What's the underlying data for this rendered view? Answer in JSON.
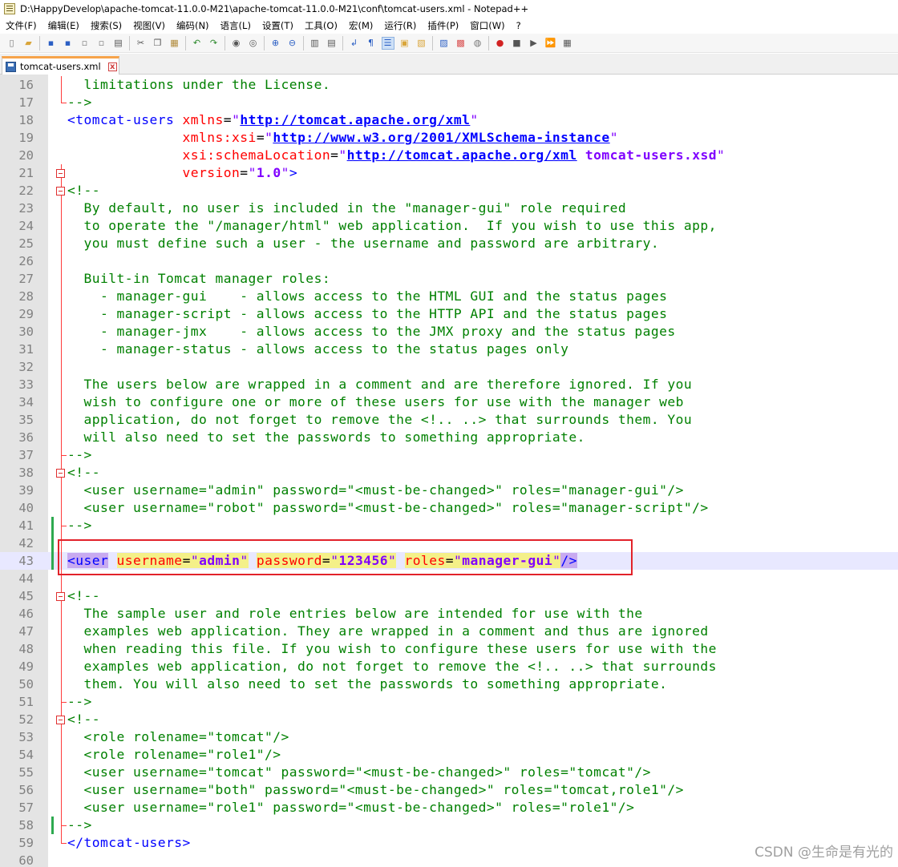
{
  "window": {
    "title": "D:\\HappyDevelop\\apache-tomcat-11.0.0-M21\\apache-tomcat-11.0.0-M21\\conf\\tomcat-users.xml - Notepad++"
  },
  "menu": [
    "文件(F)",
    "编辑(E)",
    "搜索(S)",
    "视图(V)",
    "编码(N)",
    "语言(L)",
    "设置(T)",
    "工具(O)",
    "宏(M)",
    "运行(R)",
    "插件(P)",
    "窗口(W)",
    "?"
  ],
  "toolbar": {
    "icons": [
      "new-file-icon",
      "open-file-icon",
      "save-icon",
      "save-all-icon",
      "close-icon",
      "close-all-icon",
      "print-icon",
      "cut-icon",
      "copy-icon",
      "paste-icon",
      "undo-icon",
      "redo-icon",
      "find-icon",
      "replace-icon",
      "zoom-in-icon",
      "zoom-out-icon",
      "sync-vertical-icon",
      "sync-horizontal-icon",
      "word-wrap-icon",
      "show-all-chars-icon",
      "indent-guide-icon",
      "language-icon",
      "doc-map-icon",
      "function-list-icon",
      "folder-as-workspace-icon",
      "monitoring-icon",
      "record-macro-icon",
      "stop-macro-icon",
      "play-macro-icon",
      "run-macro-multiple-icon",
      "save-macro-icon"
    ]
  },
  "tab": {
    "label": "tomcat-users.xml",
    "close": "x"
  },
  "editor": {
    "lines": [
      {
        "n": "16",
        "parts": [
          [
            "c-cmt",
            "  limitations under the License."
          ]
        ]
      },
      {
        "n": "17",
        "parts": [
          [
            "c-cmt",
            "-->"
          ]
        ]
      },
      {
        "n": "18",
        "parts": [
          [
            "c-tag",
            "<tomcat-users "
          ],
          [
            "c-attr",
            "xmlns"
          ],
          [
            "c-eq",
            "="
          ],
          [
            "c-q",
            "\""
          ],
          [
            "c-url",
            "http://tomcat.apache.org/xml"
          ],
          [
            "c-q",
            "\""
          ]
        ]
      },
      {
        "n": "19",
        "parts": [
          [
            "c-plain",
            "              "
          ],
          [
            "c-attr",
            "xmlns:xsi"
          ],
          [
            "c-eq",
            "="
          ],
          [
            "c-q",
            "\""
          ],
          [
            "c-url",
            "http://www.w3.org/2001/XMLSchema-instance"
          ],
          [
            "c-q",
            "\""
          ]
        ]
      },
      {
        "n": "20",
        "parts": [
          [
            "c-plain",
            "              "
          ],
          [
            "c-attr",
            "xsi:schemaLocation"
          ],
          [
            "c-eq",
            "="
          ],
          [
            "c-q",
            "\""
          ],
          [
            "c-url",
            "http://tomcat.apache.org/xml"
          ],
          [
            "c-val",
            " tomcat-users.xsd"
          ],
          [
            "c-q",
            "\""
          ]
        ]
      },
      {
        "n": "21",
        "parts": [
          [
            "c-plain",
            "              "
          ],
          [
            "c-attr",
            "version"
          ],
          [
            "c-eq",
            "="
          ],
          [
            "c-q",
            "\""
          ],
          [
            "c-val",
            "1.0"
          ],
          [
            "c-q",
            "\""
          ],
          [
            "c-tag",
            ">"
          ]
        ]
      },
      {
        "n": "22",
        "parts": [
          [
            "c-cmt",
            "<!--"
          ]
        ]
      },
      {
        "n": "23",
        "parts": [
          [
            "c-cmt",
            "  By default, no user is included in the \"manager-gui\" role required"
          ]
        ]
      },
      {
        "n": "24",
        "parts": [
          [
            "c-cmt",
            "  to operate the \"/manager/html\" web application.  If you wish to use this app,"
          ]
        ]
      },
      {
        "n": "25",
        "parts": [
          [
            "c-cmt",
            "  you must define such a user - the username and password are arbitrary."
          ]
        ]
      },
      {
        "n": "26",
        "parts": [
          [
            "c-cmt",
            ""
          ]
        ]
      },
      {
        "n": "27",
        "parts": [
          [
            "c-cmt",
            "  Built-in Tomcat manager roles:"
          ]
        ]
      },
      {
        "n": "28",
        "parts": [
          [
            "c-cmt",
            "    - manager-gui    - allows access to the HTML GUI and the status pages"
          ]
        ]
      },
      {
        "n": "29",
        "parts": [
          [
            "c-cmt",
            "    - manager-script - allows access to the HTTP API and the status pages"
          ]
        ]
      },
      {
        "n": "30",
        "parts": [
          [
            "c-cmt",
            "    - manager-jmx    - allows access to the JMX proxy and the status pages"
          ]
        ]
      },
      {
        "n": "31",
        "parts": [
          [
            "c-cmt",
            "    - manager-status - allows access to the status pages only"
          ]
        ]
      },
      {
        "n": "32",
        "parts": [
          [
            "c-cmt",
            ""
          ]
        ]
      },
      {
        "n": "33",
        "parts": [
          [
            "c-cmt",
            "  The users below are wrapped in a comment and are therefore ignored. If you"
          ]
        ]
      },
      {
        "n": "34",
        "parts": [
          [
            "c-cmt",
            "  wish to configure one or more of these users for use with the manager web"
          ]
        ]
      },
      {
        "n": "35",
        "parts": [
          [
            "c-cmt",
            "  application, do not forget to remove the <!.. ..> that surrounds them. You"
          ]
        ]
      },
      {
        "n": "36",
        "parts": [
          [
            "c-cmt",
            "  will also need to set the passwords to something appropriate."
          ]
        ]
      },
      {
        "n": "37",
        "parts": [
          [
            "c-cmt",
            "-->"
          ]
        ]
      },
      {
        "n": "38",
        "parts": [
          [
            "c-cmt",
            "<!--"
          ]
        ]
      },
      {
        "n": "39",
        "parts": [
          [
            "c-cmt",
            "  <user username=\"admin\" password=\"<must-be-changed>\" roles=\"manager-gui\"/>"
          ]
        ]
      },
      {
        "n": "40",
        "parts": [
          [
            "c-cmt",
            "  <user username=\"robot\" password=\"<must-be-changed>\" roles=\"manager-script\"/>"
          ]
        ]
      },
      {
        "n": "41",
        "parts": [
          [
            "c-cmt",
            "-->"
          ]
        ]
      },
      {
        "n": "42",
        "parts": [
          [
            "c-plain",
            ""
          ]
        ]
      },
      {
        "n": "43",
        "caret": true,
        "parts": [
          [
            "c-tag hl-tag",
            "<user"
          ],
          [
            "c-plain",
            " "
          ],
          [
            "c-attr hl-attr",
            "username"
          ],
          [
            "c-eq hl-attr",
            "="
          ],
          [
            "c-q hl-attr",
            "\""
          ],
          [
            "c-val hl-attr",
            "admin"
          ],
          [
            "c-q hl-attr",
            "\""
          ],
          [
            "c-plain",
            " "
          ],
          [
            "c-attr hl-attr",
            "password"
          ],
          [
            "c-eq hl-attr",
            "="
          ],
          [
            "c-q hl-attr",
            "\""
          ],
          [
            "c-val hl-attr",
            "123456"
          ],
          [
            "c-q hl-attr",
            "\""
          ],
          [
            "c-plain",
            " "
          ],
          [
            "c-attr hl-attr",
            "roles"
          ],
          [
            "c-eq hl-attr",
            "="
          ],
          [
            "c-q hl-attr",
            "\""
          ],
          [
            "c-val hl-attr",
            "manager-gui"
          ],
          [
            "c-q hl-attr",
            "\""
          ],
          [
            "c-tag hl-tag",
            "/>"
          ]
        ]
      },
      {
        "n": "44",
        "parts": [
          [
            "c-plain",
            ""
          ]
        ]
      },
      {
        "n": "45",
        "parts": [
          [
            "c-cmt",
            "<!--"
          ]
        ]
      },
      {
        "n": "46",
        "parts": [
          [
            "c-cmt",
            "  The sample user and role entries below are intended for use with the"
          ]
        ]
      },
      {
        "n": "47",
        "parts": [
          [
            "c-cmt",
            "  examples web application. They are wrapped in a comment and thus are ignored"
          ]
        ]
      },
      {
        "n": "48",
        "parts": [
          [
            "c-cmt",
            "  when reading this file. If you wish to configure these users for use with the"
          ]
        ]
      },
      {
        "n": "49",
        "parts": [
          [
            "c-cmt",
            "  examples web application, do not forget to remove the <!.. ..> that surrounds"
          ]
        ]
      },
      {
        "n": "50",
        "parts": [
          [
            "c-cmt",
            "  them. You will also need to set the passwords to something appropriate."
          ]
        ]
      },
      {
        "n": "51",
        "parts": [
          [
            "c-cmt",
            "-->"
          ]
        ]
      },
      {
        "n": "52",
        "parts": [
          [
            "c-cmt",
            "<!--"
          ]
        ]
      },
      {
        "n": "53",
        "parts": [
          [
            "c-cmt",
            "  <role rolename=\"tomcat\"/>"
          ]
        ]
      },
      {
        "n": "54",
        "parts": [
          [
            "c-cmt",
            "  <role rolename=\"role1\"/>"
          ]
        ]
      },
      {
        "n": "55",
        "parts": [
          [
            "c-cmt",
            "  <user username=\"tomcat\" password=\"<must-be-changed>\" roles=\"tomcat\"/>"
          ]
        ]
      },
      {
        "n": "56",
        "parts": [
          [
            "c-cmt",
            "  <user username=\"both\" password=\"<must-be-changed>\" roles=\"tomcat,role1\"/>"
          ]
        ]
      },
      {
        "n": "57",
        "parts": [
          [
            "c-cmt",
            "  <user username=\"role1\" password=\"<must-be-changed>\" roles=\"role1\"/>"
          ]
        ]
      },
      {
        "n": "58",
        "parts": [
          [
            "c-cmt",
            "-->"
          ]
        ]
      },
      {
        "n": "59",
        "parts": [
          [
            "c-tag",
            "</tomcat-users>"
          ]
        ]
      },
      {
        "n": "60",
        "parts": [
          [
            "c-plain",
            ""
          ]
        ]
      }
    ]
  },
  "colors": {
    "comment": "#008000",
    "tag": "#0000ff",
    "attribute": "#ff0000",
    "value": "#8000ff",
    "highlight_box": "#e2222a",
    "fold_marker": "#ff3b3b",
    "change_marker": "#2da94f"
  },
  "watermark": "CSDN @生命是有光的"
}
